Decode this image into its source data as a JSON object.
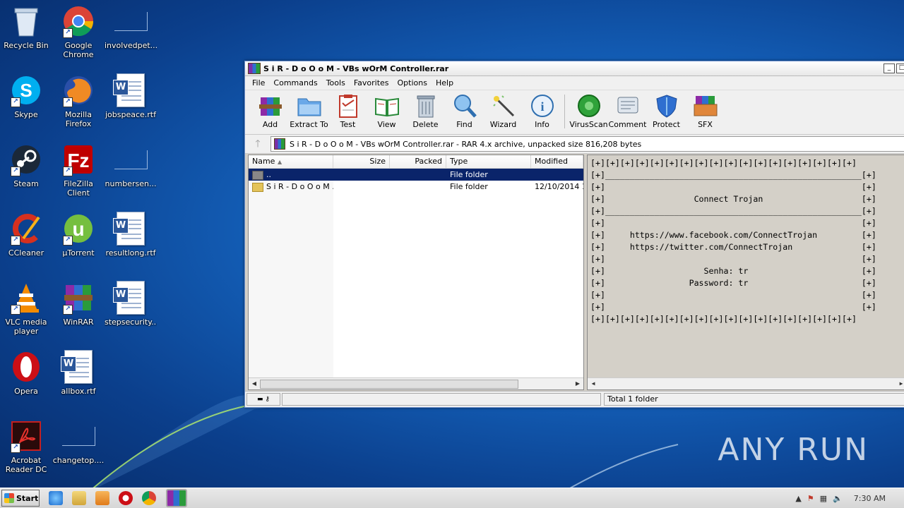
{
  "desktop": {
    "icons": [
      {
        "label": "Recycle Bin",
        "icon": "recycle-bin-icon"
      },
      {
        "label": "Google Chrome",
        "icon": "chrome-icon"
      },
      {
        "label": "involvedpet...",
        "icon": "blank-file-icon"
      },
      {
        "label": "Skype",
        "icon": "skype-icon"
      },
      {
        "label": "Mozilla Firefox",
        "icon": "firefox-icon"
      },
      {
        "label": "jobspeace.rtf",
        "icon": "word-doc-icon"
      },
      {
        "label": "Steam",
        "icon": "steam-icon"
      },
      {
        "label": "FileZilla Client",
        "icon": "filezilla-icon"
      },
      {
        "label": "numbersen...",
        "icon": "blank-file-icon"
      },
      {
        "label": "CCleaner",
        "icon": "ccleaner-icon"
      },
      {
        "label": "µTorrent",
        "icon": "utorrent-icon"
      },
      {
        "label": "resultlong.rtf",
        "icon": "word-doc-icon"
      },
      {
        "label": "VLC media player",
        "icon": "vlc-icon"
      },
      {
        "label": "WinRAR",
        "icon": "winrar-icon"
      },
      {
        "label": "stepsecurity....",
        "icon": "word-doc-icon"
      },
      {
        "label": "Opera",
        "icon": "opera-icon"
      },
      {
        "label": "allbox.rtf",
        "icon": "word-doc-icon"
      },
      {
        "label": "Acrobat Reader DC",
        "icon": "acrobat-icon"
      },
      {
        "label": "changetop....",
        "icon": "blank-file-icon"
      }
    ]
  },
  "window": {
    "title": "S i R - D o O o M - VBs wOrM Controller.rar",
    "menu": [
      "File",
      "Commands",
      "Tools",
      "Favorites",
      "Options",
      "Help"
    ],
    "toolbar": [
      "Add",
      "Extract To",
      "Test",
      "View",
      "Delete",
      "Find",
      "Wizard",
      "Info",
      "VirusScan",
      "Comment",
      "Protect",
      "SFX"
    ],
    "address": "S i R - D o O o M - VBs wOrM Controller.rar - RAR 4.x archive, unpacked size 816,208 bytes",
    "columns": [
      "Name",
      "Size",
      "Packed",
      "Type",
      "Modified"
    ],
    "rows": [
      {
        "name": "..",
        "size": "",
        "packed": "",
        "type": "File folder",
        "modified": ""
      },
      {
        "name": "S i R - D o O o M ...",
        "size": "",
        "packed": "",
        "type": "File folder",
        "modified": "12/10/2014 1:"
      }
    ],
    "comment_text": "[+][+][+][+][+][+][+][+][+][+][+][+][+][+][+][+][+][+]\n[+]____________________________________________________[+]\n[+]                                                    [+]\n[+]                  Connect Trojan                    [+]\n[+]____________________________________________________[+]\n[+]                                                    [+]\n[+]     https://www.facebook.com/ConnectTrojan         [+]\n[+]     https://twitter.com/ConnectTrojan              [+]\n[+]                                                    [+]\n[+]                    Senha: tr                       [+]\n[+]                 Password: tr                       [+]\n[+]                                                    [+]\n[+]                                                    [+]\n[+][+][+][+][+][+][+][+][+][+][+][+][+][+][+][+][+][+]",
    "status_right": "Total 1 folder"
  },
  "taskbar": {
    "start_label": "Start",
    "clock": "7:30 AM"
  },
  "watermark": "ANY RUN",
  "colors": {
    "selection": "#0a246a",
    "window_bg": "#d4d0c8"
  }
}
